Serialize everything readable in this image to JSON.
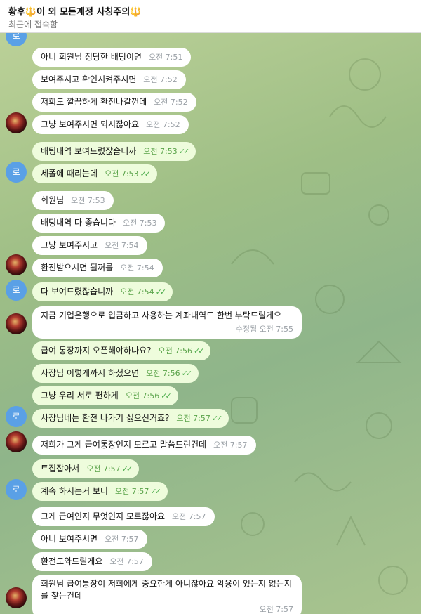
{
  "header": {
    "title": "황후🔱이 외 모든계정 사칭주의🔱",
    "status": "최근에 접속함"
  },
  "avatar_initial": "로",
  "messages": [
    {
      "text": "아니 회원님 정당한 배팅이면",
      "time": "오전 7:51",
      "dir": "in"
    },
    {
      "text": "보여주시고 확인시켜주시면",
      "time": "오전 7:52",
      "dir": "in"
    },
    {
      "text": "저희도 깔끔하게 환전나갈껀데",
      "time": "오전 7:52",
      "dir": "in"
    },
    {
      "text": "그냥 보여주시면 되시잖아요",
      "time": "오전 7:52",
      "dir": "in"
    },
    {
      "text": "배팅내역 보여드렸잖습니까",
      "time": "오전 7:53",
      "dir": "out"
    },
    {
      "text": "세폴에 때리는데",
      "time": "오전 7:53",
      "dir": "out"
    },
    {
      "text": "회원님",
      "time": "오전 7:53",
      "dir": "in"
    },
    {
      "text": "배팅내역 다 좋습니다",
      "time": "오전 7:53",
      "dir": "in"
    },
    {
      "text": "그냥 보여주시고",
      "time": "오전 7:54",
      "dir": "in"
    },
    {
      "text": "환전받으시면 될꺼를",
      "time": "오전 7:54",
      "dir": "in"
    },
    {
      "text": "다 보여드렸잖습니까",
      "time": "오전 7:54",
      "dir": "out"
    },
    {
      "text": "지금 기업은행으로 입금하고 사용하는 계좌내역도 한번 부탁드릴게요",
      "time": "수정됨 오전 7:55",
      "dir": "in"
    },
    {
      "text": "급여 통장까지 오픈해야하나요?",
      "time": "오전 7:56",
      "dir": "out"
    },
    {
      "text": "사장님 이렇게까지 하셨으면",
      "time": "오전 7:56",
      "dir": "out"
    },
    {
      "text": "그냥 우리 서로 편하게",
      "time": "오전 7:56",
      "dir": "out"
    },
    {
      "text": "사장님네는 환전 나가기 싫으신거죠?",
      "time": "오전 7:57",
      "dir": "out"
    },
    {
      "text": "저희가 그게 급여통장인지 모르고 말씀드린건데",
      "time": "오전 7:57",
      "dir": "in"
    },
    {
      "text": "트집잡아서",
      "time": "오전 7:57",
      "dir": "out"
    },
    {
      "text": "계속 하시는거 보니",
      "time": "오전 7:57",
      "dir": "out"
    },
    {
      "text": "그게 급여인지 무엇인지 모르잖아요",
      "time": "오전 7:57",
      "dir": "in"
    },
    {
      "text": "아니 보여주시면",
      "time": "오전 7:57",
      "dir": "in"
    },
    {
      "text": "환전도와드릴게요",
      "time": "오전 7:57",
      "dir": "in"
    },
    {
      "text": "회원님 급여통장이 저희에게 중요한게 아니잖아요 악용이 있는지 없는지를 찾는건데",
      "time": "오전 7:57",
      "dir": "in"
    }
  ]
}
